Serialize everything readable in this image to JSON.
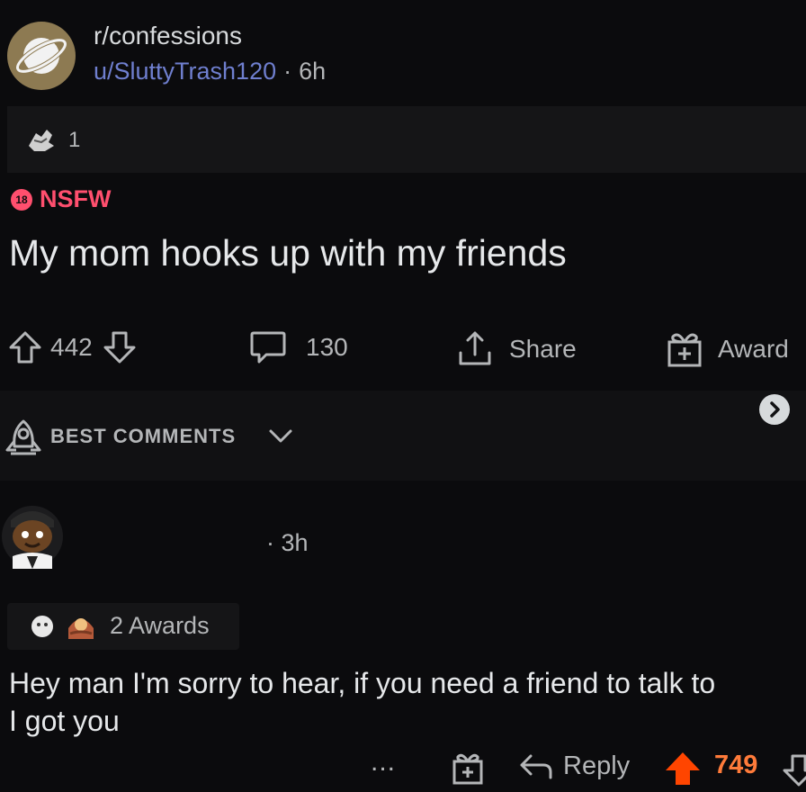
{
  "post": {
    "subreddit": "r/confessions",
    "author": "u/SluttyTrash120",
    "separator": "·",
    "age": "6h",
    "award_count": "1",
    "nsfw_label": "NSFW",
    "nsfw_badge": "18",
    "title": "My mom hooks up with my friends",
    "upvotes": "442",
    "comments": "130",
    "share_label": "Share",
    "award_label": "Award"
  },
  "sort": {
    "label": "BEST COMMENTS"
  },
  "comment": {
    "age": "· 3h",
    "awards_label": "2 Awards",
    "body_line1": "Hey man I'm sorry to hear, if you need a friend to talk to",
    "body_line2": "I got you",
    "more_label": "...",
    "reply_label": "Reply",
    "score": "749"
  },
  "colors": {
    "background": "#0b0b0d",
    "username": "#6f7fcf",
    "nsfw": "#ff4f6e",
    "upvoted": "#ff7b3a"
  }
}
